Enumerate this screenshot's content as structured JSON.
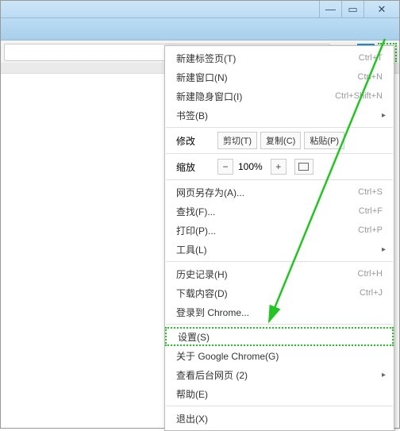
{
  "window": {
    "min": "—",
    "max": "▭",
    "close": "✕"
  },
  "toolbar": {
    "newtab": "+"
  },
  "menu": {
    "newTab": {
      "label": "新建标签页(T)",
      "shortcut": "Ctrl+T"
    },
    "newWindow": {
      "label": "新建窗口(N)",
      "shortcut": "Ctrl+N"
    },
    "incognito": {
      "label": "新建隐身窗口(I)",
      "shortcut": "Ctrl+Shift+N"
    },
    "bookmarks": {
      "label": "书签(B)"
    },
    "editLabel": "修改",
    "edit": {
      "cut": "剪切(T)",
      "copy": "复制(C)",
      "paste": "粘贴(P)"
    },
    "zoomLabel": "缩放",
    "zoom": {
      "minus": "−",
      "value": "100%",
      "plus": "+"
    },
    "saveAs": {
      "label": "网页另存为(A)...",
      "shortcut": "Ctrl+S"
    },
    "find": {
      "label": "查找(F)...",
      "shortcut": "Ctrl+F"
    },
    "print": {
      "label": "打印(P)...",
      "shortcut": "Ctrl+P"
    },
    "tools": {
      "label": "工具(L)"
    },
    "history": {
      "label": "历史记录(H)",
      "shortcut": "Ctrl+H"
    },
    "downloads": {
      "label": "下载内容(D)",
      "shortcut": "Ctrl+J"
    },
    "signin": {
      "label": "登录到 Chrome..."
    },
    "settings": {
      "label": "设置(S)"
    },
    "about": {
      "label": "关于 Google Chrome(G)"
    },
    "bgPages": {
      "label": "查看后台网页 (2)"
    },
    "help": {
      "label": "帮助(E)"
    },
    "exit": {
      "label": "退出(X)"
    }
  }
}
